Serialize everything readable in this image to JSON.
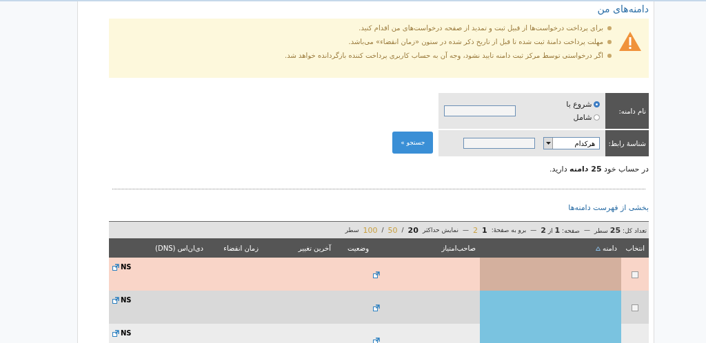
{
  "page_title": "دامنه‌های من",
  "notices": [
    "برای پرداخت درخواست‌ها از قبیل ثبت و تمدید از صفحه درخواست‌های من اقدام کنید.",
    "مهلت پرداخت دامنهٔ ثبت شده تا قبل از تاریخ ذکر شده در ستون «زمان انقضاء» می‌باشد.",
    "اگر درخواستی توسط مرکز ثبت دامنه تایید نشود، وجه آن به حساب کاربری پرداخت کننده بازگردانده خواهد شد."
  ],
  "search_form": {
    "name_label": "نام دامنه:",
    "match_options": [
      {
        "label": "شروع با",
        "selected": true
      },
      {
        "label": "شامل",
        "selected": false
      }
    ],
    "contact_label": "شناسهٔ رابط:",
    "contact_select": "هرکدام",
    "button": "جستجو »"
  },
  "account_summary": "در حساب خود **25 دامنه** دارید.",
  "list_title": "بخشی از فهرست دامنه‌ها",
  "pager": {
    "total": "تعداد کل: **25** سطر",
    "separators": [
      "—",
      "—",
      "—"
    ],
    "page": "صفحه: **1** از **2**",
    "goto_label": "برو به صفحهٔ:",
    "pages": [
      {
        "label": "1",
        "selected": true
      },
      {
        "label": "2",
        "selected": false
      }
    ],
    "show_label": "نمایش حداکثر",
    "sizes": [
      {
        "label": "20",
        "selected": true
      },
      {
        "label": "50",
        "selected": false
      },
      {
        "label": "100",
        "selected": false
      }
    ],
    "size_separators": [
      "/",
      "/"
    ],
    "rows_word": "سطر"
  },
  "table": {
    "columns": [
      "انتخاب",
      "دامنه",
      "صاحب‌امتیاز",
      "وضعیت",
      "آخرین تغییر",
      "زمان انقضاء",
      "دی‌ان‌اس (DNS)"
    ],
    "rows": [
      {
        "kind": "alert",
        "color": "#d4b09e",
        "checked": false,
        "dns": "NS"
      },
      {
        "kind": "normal",
        "color": "#7ac3e0",
        "checked": false,
        "dns": "NS"
      },
      {
        "kind": "normal",
        "color": "#7ac3e0",
        "dns": "NS"
      }
    ]
  }
}
